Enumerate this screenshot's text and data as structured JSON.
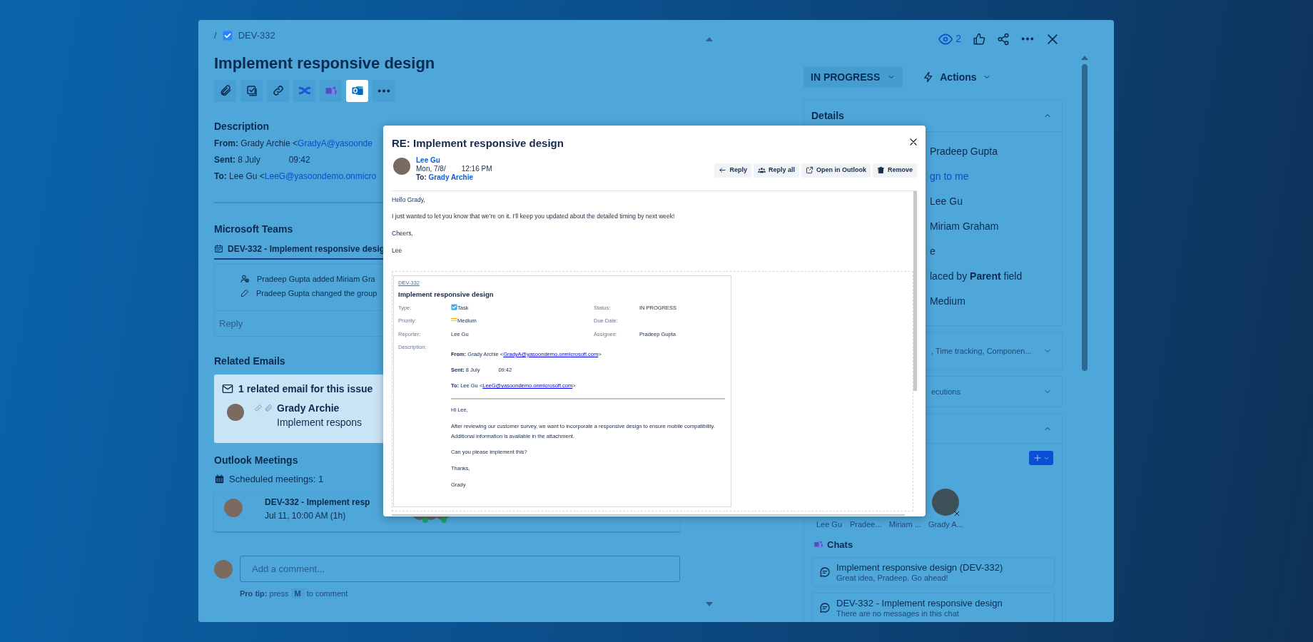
{
  "breadcrumb": {
    "separator": "/",
    "issue_key": "DEV-332"
  },
  "issue_title": "Implement responsive design",
  "toolbar": [
    {
      "kind": "attachment",
      "selected": false
    },
    {
      "kind": "checklist",
      "selected": false
    },
    {
      "kind": "link",
      "selected": false
    },
    {
      "kind": "swirl",
      "selected": false
    },
    {
      "kind": "teams",
      "selected": false
    },
    {
      "kind": "outlook",
      "selected": true
    },
    {
      "kind": "more",
      "selected": false
    }
  ],
  "description": {
    "heading": "Description",
    "from": {
      "label": "From:",
      "text": "Grady Archie <",
      "link": "GradyA@yasoonde"
    },
    "sent": {
      "label": "Sent:",
      "date": "8 July",
      "time": "09:42"
    },
    "to": {
      "label": "To:",
      "text": "Lee Gu <",
      "link": "LeeG@yasoondemo.onmicro"
    }
  },
  "teams": {
    "heading": "Microsoft Teams",
    "channel": "DEV-332 - Implement responsive desig",
    "activities": [
      {
        "kind": "member",
        "text": "Pradeep Gupta added Miriam Gra"
      },
      {
        "kind": "edit",
        "text": "Pradeep Gupta changed the group"
      }
    ],
    "reply_placeholder": "Reply"
  },
  "related_emails": {
    "heading": "Related Emails",
    "summary": "1 related email for this issue",
    "email": {
      "sender": "Grady Archie",
      "subject": "Implement respons"
    }
  },
  "meetings": {
    "heading": "Outlook Meetings",
    "count": "Scheduled meetings: 1",
    "meeting": {
      "title": "DEV-332 - Implement resp",
      "time": "Jul 11, 10:00 AM (1h)"
    }
  },
  "comment": {
    "placeholder": "Add a comment...",
    "tip_label": "Pro tip:",
    "tip_before": "press",
    "key": "M",
    "tip_after": "to comment"
  },
  "header_actions": {
    "watchers": "2"
  },
  "status": {
    "label": "IN PROGRESS",
    "actions": "Actions"
  },
  "details": {
    "heading": "Details",
    "expanded": true,
    "rows": [
      {
        "kind": "user",
        "text": "Pradeep Gupta"
      },
      {
        "kind": "link",
        "text": "gn to me"
      },
      {
        "kind": "user",
        "text": "Lee Gu"
      },
      {
        "kind": "user",
        "text": "Miriam Graham"
      },
      {
        "kind": "text",
        "text": "e"
      },
      {
        "kind": "text",
        "text": "laced by **Parent** field"
      },
      {
        "kind": "text",
        "text": "Medium"
      }
    ]
  },
  "collapsed_sections": [
    {
      "text": ", Time tracking, Componen...",
      "expanded": false
    },
    {
      "text": "ecutions",
      "expanded": false
    }
  ],
  "people_panel": {
    "expanded": true,
    "participants": [
      {
        "name": "Lee Gu",
        "removable": false
      },
      {
        "name": "Pradee...",
        "removable": false
      },
      {
        "name": "Miriam ...",
        "removable": false
      },
      {
        "name": "Grady A...",
        "removable": true
      }
    ],
    "chats_heading": "Chats",
    "chats": [
      {
        "title": "Implement responsive design (DEV-332)",
        "preview": "Great idea, Pradeep. Go ahead!"
      },
      {
        "title": "DEV-332 - Implement responsive design",
        "preview": "There are no messages in this chat"
      }
    ]
  },
  "email_modal": {
    "title": "RE: Implement responsive design",
    "sender": "Lee Gu",
    "date": "Mon, 7/8/",
    "time": "12:16 PM",
    "to_label": "To:",
    "to": "Grady Archie",
    "buttons": [
      {
        "kind": "reply",
        "label": "Reply"
      },
      {
        "kind": "reply_all",
        "label": "Reply all"
      },
      {
        "kind": "open",
        "label": "Open in Outlook"
      },
      {
        "kind": "remove",
        "label": "Remove"
      }
    ],
    "body": [
      "Hello Grady,",
      "I just wanted to let you know that we’re on it. I’ll keep you updated about the detailed timing by next week!",
      "Cheers,",
      "Lee"
    ],
    "issue_card": {
      "key": "DEV-332",
      "title": "Implement responsive design",
      "fields": [
        {
          "label": "Type:",
          "value": "Task",
          "kind": "type"
        },
        {
          "label": "Status:",
          "value": "IN PROGRESS",
          "kind": "text"
        },
        {
          "label": "Priority:",
          "value": "Medium",
          "kind": "priority"
        },
        {
          "label": "Due Date:",
          "kind": "text"
        },
        {
          "label": "Reporter:",
          "value": "Lee Gu",
          "kind": "text"
        },
        {
          "label": "Assignee:",
          "value": "Pradeep Gupta",
          "kind": "text"
        }
      ],
      "description_label": "Description:",
      "from": {
        "label": "From:",
        "text": "Grady Archie <",
        "link": "GradyA@yasoondemo.onmicrosoft.com",
        "after": ">"
      },
      "sent": {
        "label": "Sent:",
        "date": "8 July",
        "time": "09:42"
      },
      "to": {
        "label": "To:",
        "text": "Lee Gu <",
        "link": "LeeG@yasoondemo.onmicrosoft.com",
        "after": ">"
      },
      "body": [
        "Hi Lee,",
        "After reviewing our customer survey, we want to incorporate a responsive design to ensure mobile compatibility.",
        "Additional information is available in the attachment.",
        "Can you please implement this?",
        "Thanks,",
        "Grady"
      ]
    }
  }
}
